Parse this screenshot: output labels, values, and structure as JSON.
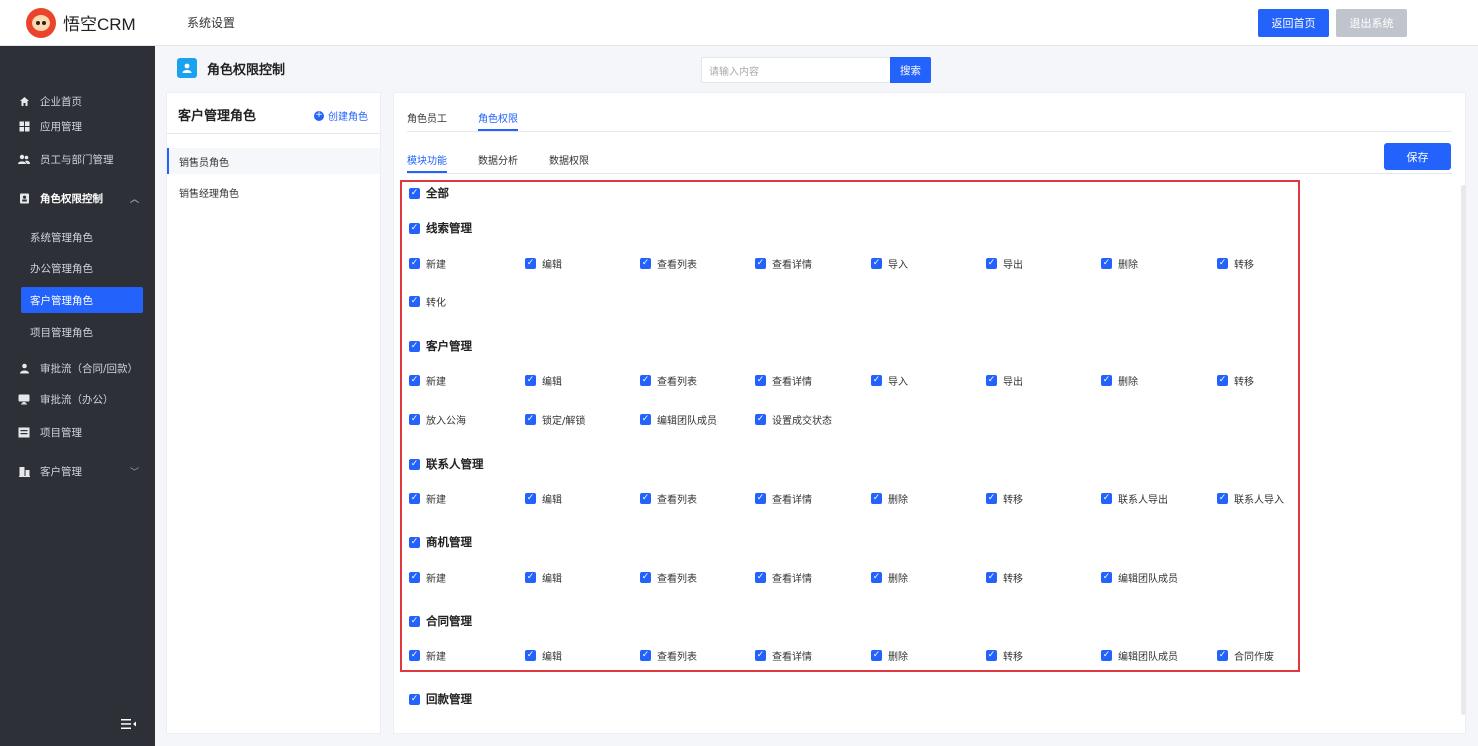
{
  "app": {
    "logo_text": "悟空CRM",
    "header_title": "系统设置",
    "return_home_label": "返回首页",
    "exit_label": "退出系统",
    "accent_color": "#2362fb",
    "highlight_color": "#e0383e"
  },
  "sidebar": {
    "items": [
      {
        "label": "企业首页",
        "icon": "home-icon"
      },
      {
        "label": "应用管理",
        "icon": "grid-icon"
      },
      {
        "label": "员工与部门管理",
        "icon": "users-icon"
      },
      {
        "label": "角色权限控制",
        "icon": "role-icon"
      },
      {
        "label": "审批流（合同/回款）",
        "icon": "person-icon"
      },
      {
        "label": "审批流（办公）",
        "icon": "monitor-icon"
      },
      {
        "label": "项目管理",
        "icon": "project-icon"
      },
      {
        "label": "客户管理",
        "icon": "customer-icon"
      }
    ],
    "sub_items": [
      "系统管理角色",
      "办公管理角色",
      "客户管理角色",
      "项目管理角色"
    ],
    "active_sub": "客户管理角色"
  },
  "page": {
    "title": "角色权限控制",
    "search_placeholder": "请输入内容",
    "search_button": "搜索"
  },
  "role_panel": {
    "title": "客户管理角色",
    "create_label": "创建角色",
    "roles": [
      "销售员角色",
      "销售经理角色"
    ],
    "active_role": "销售员角色"
  },
  "main": {
    "tabs": [
      "角色员工",
      "角色权限"
    ],
    "active_tab": "角色权限",
    "sub_tabs": [
      "模块功能",
      "数据分析",
      "数据权限"
    ],
    "active_sub_tab": "模块功能",
    "save_label": "保存"
  },
  "permissions": {
    "all_label": "全部",
    "groups": [
      {
        "name": "线索管理",
        "items": [
          "新建",
          "编辑",
          "查看列表",
          "查看详情",
          "导入",
          "导出",
          "删除",
          "转移",
          "转化"
        ]
      },
      {
        "name": "客户管理",
        "items": [
          "新建",
          "编辑",
          "查看列表",
          "查看详情",
          "导入",
          "导出",
          "删除",
          "转移",
          "放入公海",
          "锁定/解锁",
          "编辑团队成员",
          "设置成交状态"
        ]
      },
      {
        "name": "联系人管理",
        "items": [
          "新建",
          "编辑",
          "查看列表",
          "查看详情",
          "删除",
          "转移",
          "联系人导出",
          "联系人导入"
        ]
      },
      {
        "name": "商机管理",
        "items": [
          "新建",
          "编辑",
          "查看列表",
          "查看详情",
          "删除",
          "转移",
          "编辑团队成员"
        ]
      },
      {
        "name": "合同管理",
        "items": [
          "新建",
          "编辑",
          "查看列表",
          "查看详情",
          "删除",
          "转移",
          "编辑团队成员",
          "合同作废"
        ]
      },
      {
        "name": "回款管理",
        "items": []
      }
    ]
  }
}
